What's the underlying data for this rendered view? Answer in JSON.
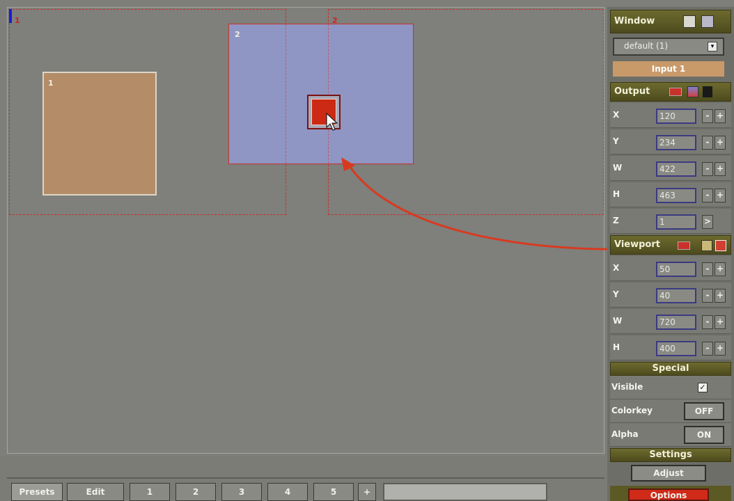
{
  "canvas": {
    "monitor_labels": [
      "1",
      "2"
    ],
    "windows": [
      {
        "label": "1",
        "color": "#b48c68"
      },
      {
        "label": "2",
        "color": "#8c94bc"
      }
    ]
  },
  "panel": {
    "window": {
      "header": "Window",
      "dropdown_value": "default (1)",
      "selected_input": "Input 1"
    },
    "output": {
      "header": "Output",
      "fields": [
        {
          "label": "X",
          "value": "120"
        },
        {
          "label": "Y",
          "value": "234"
        },
        {
          "label": "W",
          "value": "422"
        },
        {
          "label": "H",
          "value": "463"
        },
        {
          "label": "Z",
          "value": "1"
        }
      ]
    },
    "viewport": {
      "header": "Viewport",
      "fields": [
        {
          "label": "X",
          "value": "50"
        },
        {
          "label": "Y",
          "value": "40"
        },
        {
          "label": "W",
          "value": "720"
        },
        {
          "label": "H",
          "value": "400"
        }
      ]
    },
    "special": {
      "header": "Special",
      "visible_label": "Visible",
      "visible_checked": true,
      "colorkey_label": "Colorkey",
      "colorkey_value": "OFF",
      "alpha_label": "Alpha",
      "alpha_value": "ON"
    },
    "settings": {
      "header": "Settings",
      "adjust_label": "Adjust",
      "options_label": "Options"
    }
  },
  "bottom": {
    "presets_label": "Presets",
    "edit_label": "Edit",
    "preset_numbers": [
      "1",
      "2",
      "3",
      "4",
      "5"
    ],
    "add_label": "+"
  },
  "colors": {
    "accent_red": "#c8322a",
    "header_olive": "#5c5a24",
    "input_highlight": "#c89a6a"
  }
}
